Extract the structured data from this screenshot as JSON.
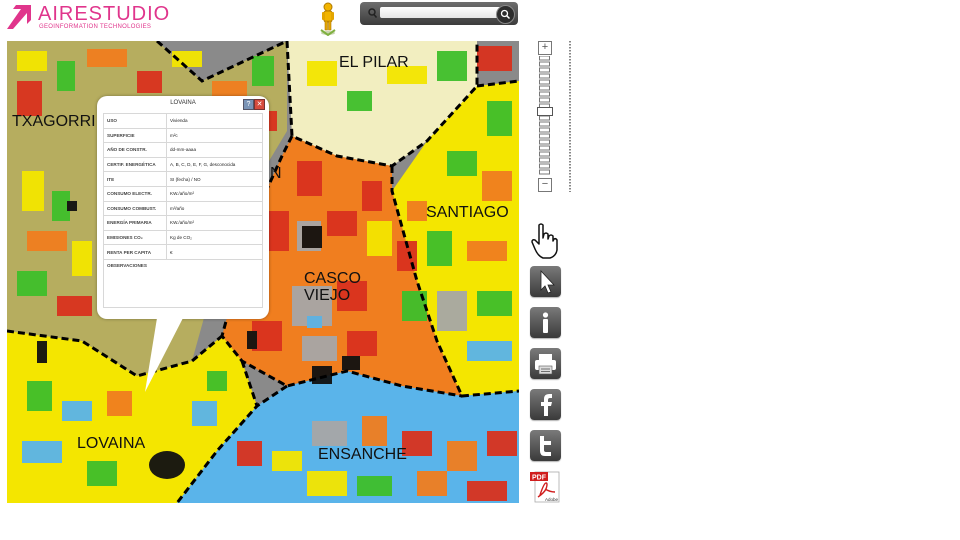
{
  "brand": {
    "name": "AIRESTUDIO",
    "tagline": "GEOINFORMATION TECHNOLOGIES",
    "color": "#e0358c"
  },
  "search": {
    "placeholder": "",
    "value": "",
    "icon": "search-icon",
    "go_icon": "search-go-icon"
  },
  "map": {
    "districts": [
      {
        "id": "el-pilar",
        "label": "EL PILAR"
      },
      {
        "id": "txagorri",
        "label": "TXAGORRI"
      },
      {
        "id": "santiago",
        "label": "SANTIAGO"
      },
      {
        "id": "casco-viejo",
        "label": "CASCO\nVIEJO"
      },
      {
        "id": "lovaina",
        "label": "LOVAINA"
      },
      {
        "id": "ensanche",
        "label": "ENSANCHE"
      },
      {
        "id": "partial-n",
        "label": "N"
      }
    ],
    "colors": {
      "yellow": "#f4e600",
      "green": "#3fbf2b",
      "orange": "#f07e1f",
      "red": "#d9321e",
      "lightblue": "#5ab4ea",
      "gray": "#a7a7a7",
      "olive": "#b6ad5f",
      "cream": "#f2eec0",
      "black": "#111111"
    }
  },
  "popup": {
    "title": "LOVAINA",
    "help": "?",
    "close": "✕",
    "rows": [
      {
        "key": "USO",
        "value": "Vivienda"
      },
      {
        "key": "SUPERFICIE",
        "value": "m²c"
      },
      {
        "key": "AÑO DE CONSTR.",
        "value": "dd-mm-aaaa"
      },
      {
        "key": "CERTIF. ENERGÉTICA",
        "value": "A, B, C, D, E, F, G, desconocida"
      },
      {
        "key": "ITE",
        "value": "SI (fecha) / NO"
      },
      {
        "key": "CONSUMO ELECTR.",
        "value": "KW./año/m²"
      },
      {
        "key": "CONSUMO COMBUST.",
        "value": "m³/año"
      },
      {
        "key": "ENERGÍA PRIMARIA",
        "value": "KW./año/m²"
      },
      {
        "key": "EMISIONES CO₂",
        "value": "Kg de CO₂"
      },
      {
        "key": "RENTA PER CAPITA",
        "value": "€"
      }
    ],
    "observaciones": {
      "key": "OBSERVACIONES",
      "value": ""
    }
  },
  "zoom": {
    "plus": "+",
    "minus": "−",
    "level_fraction": 0.45
  },
  "tools": [
    {
      "id": "pan",
      "icon": "hand-cursor-icon"
    },
    {
      "id": "select",
      "icon": "arrow-cursor-icon"
    },
    {
      "id": "info",
      "icon": "info-icon"
    },
    {
      "id": "print",
      "icon": "printer-icon"
    },
    {
      "id": "facebook",
      "icon": "facebook-icon"
    },
    {
      "id": "twitter",
      "icon": "twitter-icon"
    },
    {
      "id": "pdf",
      "icon": "pdf-icon"
    }
  ],
  "pdf_label": {
    "top": "PDF",
    "bottom": "Adobe"
  }
}
